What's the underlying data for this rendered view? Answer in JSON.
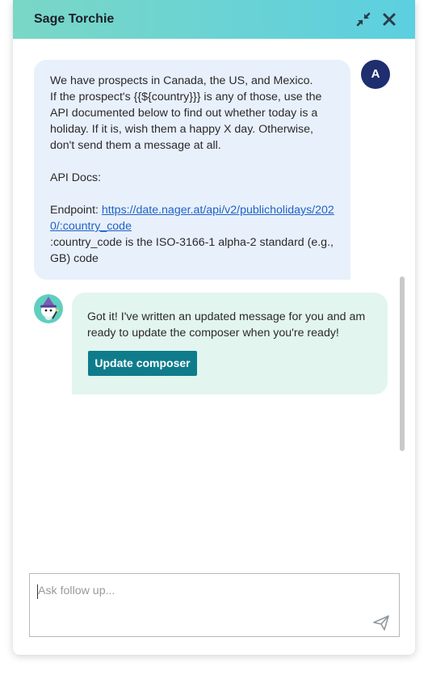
{
  "header": {
    "title": "Sage Torchie",
    "minimize_icon": "minimize-arrows-icon",
    "close_icon": "close-icon",
    "gradient": [
      "#7ad7c6",
      "#5ccfe0"
    ]
  },
  "conversation": {
    "user_message": {
      "avatar_initial": "A",
      "avatar_color": "#1e2e6e",
      "bubble_color": "#e8f0fc",
      "line1": "We have prospects in Canada, the US, and Mexico.",
      "line2": "If the prospect's {{${country}}} is any of those, use the API documented below to find out whether today is a holiday. If it is, wish them a happy X day. Otherwise, don't send them a message at all.",
      "api_docs_heading": "API Docs:",
      "endpoint_label": "Endpoint: ",
      "endpoint_url": "https://date.nager.at/api/v2/publicholidays/2020/:country_code",
      "country_code_note": ":country_code is the ISO-3166-1 alpha-2 standard (e.g., GB) code"
    },
    "bot_message": {
      "avatar_icon": "wizard-bot-icon",
      "bubble_color": "#e2f5ee",
      "text": "Got it! I've written an updated message for you and am ready to update the composer when you're ready!",
      "button_label": "Update composer",
      "button_color": "#0f7c8c"
    }
  },
  "composer": {
    "placeholder": "Ask follow up...",
    "value": "",
    "send_icon": "send-paper-plane-icon"
  }
}
